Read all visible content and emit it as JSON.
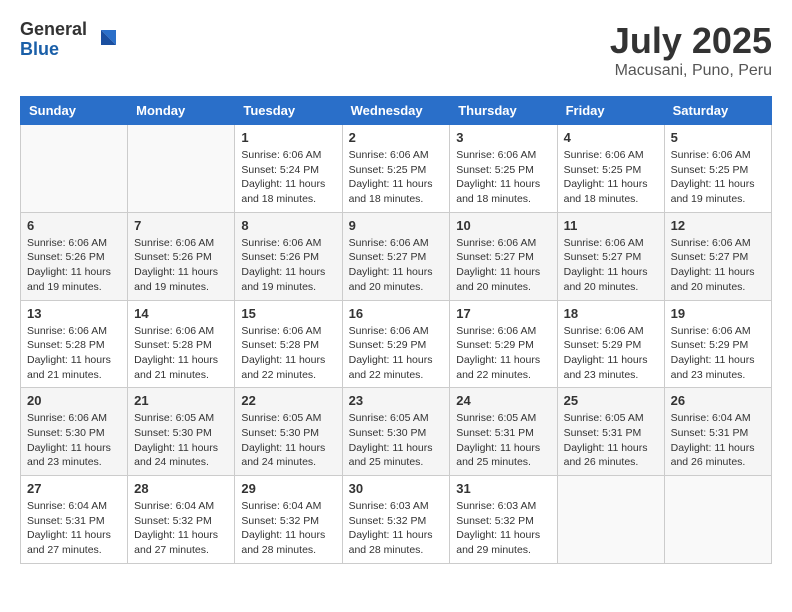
{
  "header": {
    "logo_general": "General",
    "logo_blue": "Blue",
    "month_title": "July 2025",
    "location": "Macusani, Puno, Peru"
  },
  "weekdays": [
    "Sunday",
    "Monday",
    "Tuesday",
    "Wednesday",
    "Thursday",
    "Friday",
    "Saturday"
  ],
  "weeks": [
    [
      {
        "day": null
      },
      {
        "day": null
      },
      {
        "day": "1",
        "sunrise": "Sunrise: 6:06 AM",
        "sunset": "Sunset: 5:24 PM",
        "daylight": "Daylight: 11 hours and 18 minutes."
      },
      {
        "day": "2",
        "sunrise": "Sunrise: 6:06 AM",
        "sunset": "Sunset: 5:25 PM",
        "daylight": "Daylight: 11 hours and 18 minutes."
      },
      {
        "day": "3",
        "sunrise": "Sunrise: 6:06 AM",
        "sunset": "Sunset: 5:25 PM",
        "daylight": "Daylight: 11 hours and 18 minutes."
      },
      {
        "day": "4",
        "sunrise": "Sunrise: 6:06 AM",
        "sunset": "Sunset: 5:25 PM",
        "daylight": "Daylight: 11 hours and 18 minutes."
      },
      {
        "day": "5",
        "sunrise": "Sunrise: 6:06 AM",
        "sunset": "Sunset: 5:25 PM",
        "daylight": "Daylight: 11 hours and 19 minutes."
      }
    ],
    [
      {
        "day": "6",
        "sunrise": "Sunrise: 6:06 AM",
        "sunset": "Sunset: 5:26 PM",
        "daylight": "Daylight: 11 hours and 19 minutes."
      },
      {
        "day": "7",
        "sunrise": "Sunrise: 6:06 AM",
        "sunset": "Sunset: 5:26 PM",
        "daylight": "Daylight: 11 hours and 19 minutes."
      },
      {
        "day": "8",
        "sunrise": "Sunrise: 6:06 AM",
        "sunset": "Sunset: 5:26 PM",
        "daylight": "Daylight: 11 hours and 19 minutes."
      },
      {
        "day": "9",
        "sunrise": "Sunrise: 6:06 AM",
        "sunset": "Sunset: 5:27 PM",
        "daylight": "Daylight: 11 hours and 20 minutes."
      },
      {
        "day": "10",
        "sunrise": "Sunrise: 6:06 AM",
        "sunset": "Sunset: 5:27 PM",
        "daylight": "Daylight: 11 hours and 20 minutes."
      },
      {
        "day": "11",
        "sunrise": "Sunrise: 6:06 AM",
        "sunset": "Sunset: 5:27 PM",
        "daylight": "Daylight: 11 hours and 20 minutes."
      },
      {
        "day": "12",
        "sunrise": "Sunrise: 6:06 AM",
        "sunset": "Sunset: 5:27 PM",
        "daylight": "Daylight: 11 hours and 20 minutes."
      }
    ],
    [
      {
        "day": "13",
        "sunrise": "Sunrise: 6:06 AM",
        "sunset": "Sunset: 5:28 PM",
        "daylight": "Daylight: 11 hours and 21 minutes."
      },
      {
        "day": "14",
        "sunrise": "Sunrise: 6:06 AM",
        "sunset": "Sunset: 5:28 PM",
        "daylight": "Daylight: 11 hours and 21 minutes."
      },
      {
        "day": "15",
        "sunrise": "Sunrise: 6:06 AM",
        "sunset": "Sunset: 5:28 PM",
        "daylight": "Daylight: 11 hours and 22 minutes."
      },
      {
        "day": "16",
        "sunrise": "Sunrise: 6:06 AM",
        "sunset": "Sunset: 5:29 PM",
        "daylight": "Daylight: 11 hours and 22 minutes."
      },
      {
        "day": "17",
        "sunrise": "Sunrise: 6:06 AM",
        "sunset": "Sunset: 5:29 PM",
        "daylight": "Daylight: 11 hours and 22 minutes."
      },
      {
        "day": "18",
        "sunrise": "Sunrise: 6:06 AM",
        "sunset": "Sunset: 5:29 PM",
        "daylight": "Daylight: 11 hours and 23 minutes."
      },
      {
        "day": "19",
        "sunrise": "Sunrise: 6:06 AM",
        "sunset": "Sunset: 5:29 PM",
        "daylight": "Daylight: 11 hours and 23 minutes."
      }
    ],
    [
      {
        "day": "20",
        "sunrise": "Sunrise: 6:06 AM",
        "sunset": "Sunset: 5:30 PM",
        "daylight": "Daylight: 11 hours and 23 minutes."
      },
      {
        "day": "21",
        "sunrise": "Sunrise: 6:05 AM",
        "sunset": "Sunset: 5:30 PM",
        "daylight": "Daylight: 11 hours and 24 minutes."
      },
      {
        "day": "22",
        "sunrise": "Sunrise: 6:05 AM",
        "sunset": "Sunset: 5:30 PM",
        "daylight": "Daylight: 11 hours and 24 minutes."
      },
      {
        "day": "23",
        "sunrise": "Sunrise: 6:05 AM",
        "sunset": "Sunset: 5:30 PM",
        "daylight": "Daylight: 11 hours and 25 minutes."
      },
      {
        "day": "24",
        "sunrise": "Sunrise: 6:05 AM",
        "sunset": "Sunset: 5:31 PM",
        "daylight": "Daylight: 11 hours and 25 minutes."
      },
      {
        "day": "25",
        "sunrise": "Sunrise: 6:05 AM",
        "sunset": "Sunset: 5:31 PM",
        "daylight": "Daylight: 11 hours and 26 minutes."
      },
      {
        "day": "26",
        "sunrise": "Sunrise: 6:04 AM",
        "sunset": "Sunset: 5:31 PM",
        "daylight": "Daylight: 11 hours and 26 minutes."
      }
    ],
    [
      {
        "day": "27",
        "sunrise": "Sunrise: 6:04 AM",
        "sunset": "Sunset: 5:31 PM",
        "daylight": "Daylight: 11 hours and 27 minutes."
      },
      {
        "day": "28",
        "sunrise": "Sunrise: 6:04 AM",
        "sunset": "Sunset: 5:32 PM",
        "daylight": "Daylight: 11 hours and 27 minutes."
      },
      {
        "day": "29",
        "sunrise": "Sunrise: 6:04 AM",
        "sunset": "Sunset: 5:32 PM",
        "daylight": "Daylight: 11 hours and 28 minutes."
      },
      {
        "day": "30",
        "sunrise": "Sunrise: 6:03 AM",
        "sunset": "Sunset: 5:32 PM",
        "daylight": "Daylight: 11 hours and 28 minutes."
      },
      {
        "day": "31",
        "sunrise": "Sunrise: 6:03 AM",
        "sunset": "Sunset: 5:32 PM",
        "daylight": "Daylight: 11 hours and 29 minutes."
      },
      {
        "day": null
      },
      {
        "day": null
      }
    ]
  ]
}
